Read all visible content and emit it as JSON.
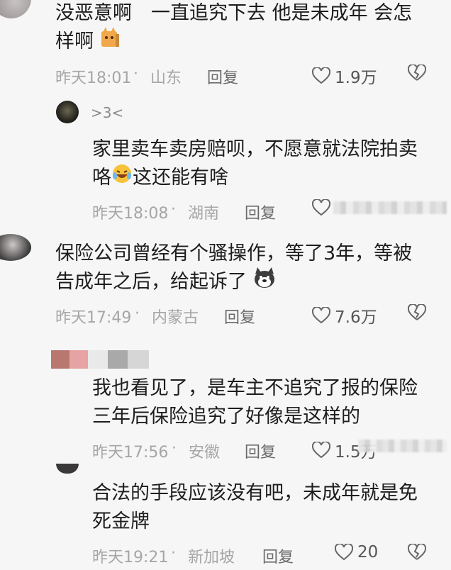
{
  "comments": [
    {
      "line1": "没恶意啊　一直追究下去 他是未成年 会怎",
      "line2": "样啊",
      "time": "昨天18:01",
      "location": "山东",
      "reply": "回复",
      "likes": "1.9万",
      "emoji": "cat-sticker-icon"
    },
    {
      "username": ">3<",
      "line1": "家里卖车卖房赔呗，不愿意就法院拍卖",
      "line2": "咯",
      "line2b": "这还能有啥",
      "time": "昨天18:08",
      "location": "湖南",
      "reply": "回复",
      "emoji": "laughing-crying-icon"
    },
    {
      "line1": "保险公司曾经有个骚操作，等了3年，等被",
      "line2": "告成年之后，给起诉了",
      "time": "昨天17:49",
      "location": "内蒙古",
      "reply": "回复",
      "likes": "7.6万",
      "emoji": "husky-dog-icon"
    },
    {
      "line1": "我也看见了，是车主不追究了报的保险",
      "line2": "三年后保险追究了好像是这样的",
      "time": "昨天17:56",
      "location": "安徽",
      "reply": "回复",
      "likes": "1.5万"
    },
    {
      "line1": "合法的手段应该没有吧，未成年就是免",
      "line2": "死金牌",
      "time": "昨天19:21",
      "location": "新加坡",
      "reply": "回复",
      "likes": "20"
    }
  ],
  "separator": "·",
  "colors": {
    "background": "#f6f6f6",
    "meta": "#a6a6a6",
    "text": "#1d1d1d"
  }
}
